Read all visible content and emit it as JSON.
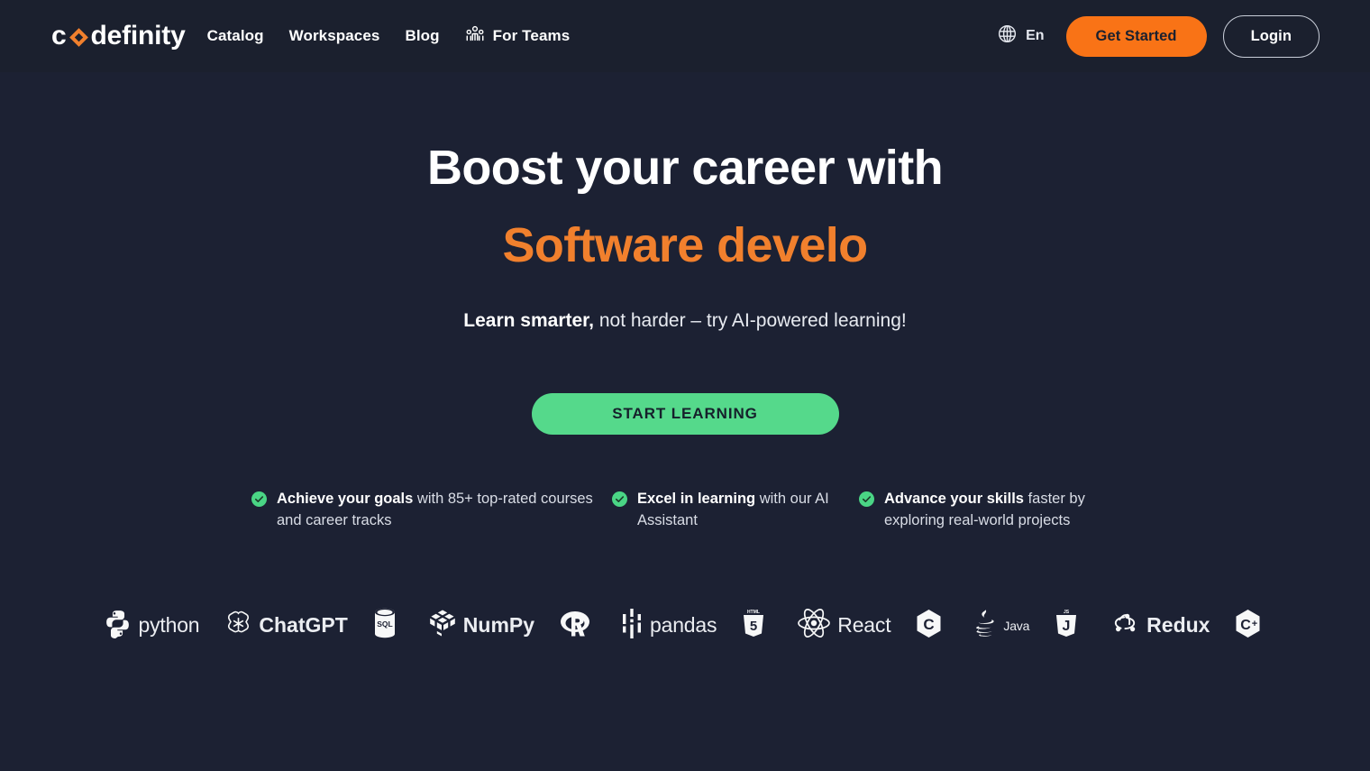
{
  "brand": {
    "name": "codefinity",
    "name_prefix": "c",
    "name_suffix": "definity",
    "logo_mark": "diamond-icon",
    "accent_color": "#f1802d",
    "green_color": "#55d98b",
    "bg_color": "#1c2133",
    "header_bg_color": "#1b202e"
  },
  "header": {
    "nav": [
      {
        "label": "Catalog",
        "icon": null
      },
      {
        "label": "Workspaces",
        "icon": null
      },
      {
        "label": "Blog",
        "icon": null
      },
      {
        "label": "For Teams",
        "icon": "people-group-icon"
      }
    ],
    "language": {
      "icon": "globe-icon",
      "label": "En"
    },
    "get_started_label": "Get Started",
    "login_label": "Login"
  },
  "hero": {
    "title_line1": "Boost your career with",
    "title_line2": "Software develo",
    "subtitle_bold": "Learn smarter,",
    "subtitle_rest": " not harder – try AI-powered learning!",
    "cta_label": "START LEARNING"
  },
  "features": [
    {
      "icon": "check-circle-icon",
      "bold": "Achieve your goals",
      "rest": " with 85+ top-rated courses and career tracks"
    },
    {
      "icon": "check-circle-icon",
      "bold": "Excel in learning",
      "rest": " with our AI Assistant"
    },
    {
      "icon": "check-circle-icon",
      "bold": "Advance your skills",
      "rest": " faster by exploring real-world projects"
    }
  ],
  "tech_logos": [
    {
      "icon": "python-icon",
      "label": "python",
      "style": "regular"
    },
    {
      "icon": "openai-icon",
      "label": "ChatGPT",
      "style": "bold"
    },
    {
      "icon": "sql-icon",
      "label": "",
      "style": "regular"
    },
    {
      "icon": "numpy-icon",
      "label": "NumPy",
      "style": "bold"
    },
    {
      "icon": "r-lang-icon",
      "label": "",
      "style": "regular"
    },
    {
      "icon": "pandas-icon",
      "label": "pandas",
      "style": "regular"
    },
    {
      "icon": "html5-icon",
      "label": "",
      "style": "regular"
    },
    {
      "icon": "react-icon",
      "label": "React",
      "style": "regular"
    },
    {
      "icon": "c-lang-icon",
      "label": "",
      "style": "regular"
    },
    {
      "icon": "java-icon",
      "label": "Java",
      "style": "small"
    },
    {
      "icon": "javascript-icon",
      "label": "",
      "style": "regular"
    },
    {
      "icon": "redux-icon",
      "label": "Redux",
      "style": "bold"
    },
    {
      "icon": "cpp-icon",
      "label": "",
      "style": "regular"
    }
  ]
}
